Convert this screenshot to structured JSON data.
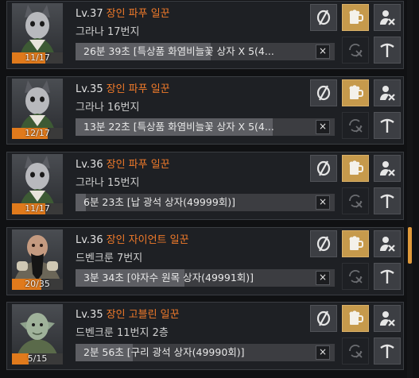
{
  "workers": [
    {
      "level": "Lv.37",
      "name": "장인 파푸 일꾼",
      "location": "그라나 17번지",
      "stamina": "11/17",
      "stamina_ratio": 0.65,
      "task": "26분 39초 [특상품 화염비늘꽃 상자 X 5(4...",
      "task_progress": 0.52,
      "portrait": "pappu-portrait-icon"
    },
    {
      "level": "Lv.35",
      "name": "장인 파푸 일꾼",
      "location": "그라나 16번지",
      "stamina": "12/17",
      "stamina_ratio": 0.71,
      "task": "13분 22초 [특상품 화염비늘꽃 상자 X 5(4...",
      "task_progress": 0.76,
      "portrait": "pappu-portrait-icon"
    },
    {
      "level": "Lv.36",
      "name": "장인 파푸 일꾼",
      "location": "그라나 15번지",
      "stamina": "11/17",
      "stamina_ratio": 0.65,
      "task": "6분 23초 [납 광석 상자(49999회)]",
      "task_progress": 0.04,
      "portrait": "pappu-portrait-icon"
    },
    {
      "level": "Lv.36",
      "name": "장인 자이언트 일꾼",
      "location": "드벤크룬 7번지",
      "stamina": "20/35",
      "stamina_ratio": 0.57,
      "task": "3분 34초 [야자수 원목 상자(49991회)]",
      "task_progress": 0.42,
      "portrait": "giant-portrait-icon"
    },
    {
      "level": "Lv.35",
      "name": "장인 고블린 일꾼",
      "location": "드벤크룬 11번지 2층",
      "stamina": "5/15",
      "stamina_ratio": 0.33,
      "task": "2분 56초 [구리 광석 상자(49990회)]",
      "task_progress": 0.22,
      "portrait": "goblin-portrait-icon"
    }
  ],
  "colors": {
    "accent": "#f07a2a",
    "stamina": "#e07a1c",
    "gold_button": "#c69a4c",
    "scrollbar": "#e09a3a"
  },
  "icons": {
    "skill": "skill-toggle-icon",
    "beer": "beer-icon",
    "fire": "fire-worker-icon",
    "repeat": "repeat-icon",
    "pick": "pickaxe-icon",
    "close": "close-icon"
  },
  "close_glyph": "×"
}
